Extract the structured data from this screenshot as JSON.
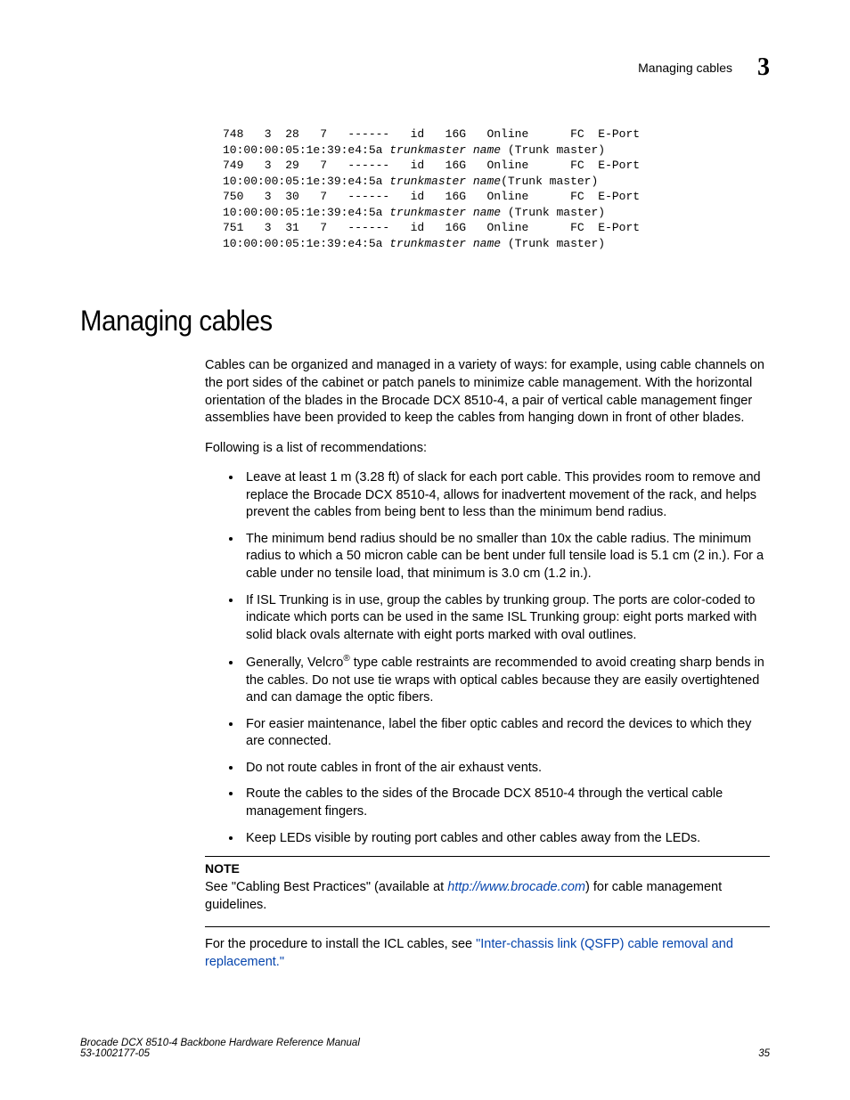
{
  "header": {
    "running_title": "Managing cables",
    "chapter_number": "3"
  },
  "code": {
    "rows": [
      {
        "line": "748   3  28   7   ------   id   16G   Online      FC  E-Port",
        "sub_pre": "10:00:00:05:1e:39:e4:5a ",
        "sub_em": "trunkmaster name",
        "sub_post": " (Trunk master)"
      },
      {
        "line": "749   3  29   7   ------   id   16G   Online      FC  E-Port",
        "sub_pre": "10:00:00:05:1e:39:e4:5a ",
        "sub_em": "trunkmaster name",
        "sub_post": "(Trunk master)"
      },
      {
        "line": "750   3  30   7   ------   id   16G   Online      FC  E-Port",
        "sub_pre": "10:00:00:05:1e:39:e4:5a ",
        "sub_em": "trunkmaster name",
        "sub_post": " (Trunk master)"
      },
      {
        "line": "751   3  31   7   ------   id   16G   Online      FC  E-Port",
        "sub_pre": "10:00:00:05:1e:39:e4:5a ",
        "sub_em": "trunkmaster name",
        "sub_post": " (Trunk master)"
      }
    ]
  },
  "section": {
    "title": "Managing cables",
    "intro1": "Cables can be organized and managed in a variety of ways: for example, using cable channels on the port sides of the cabinet or patch panels to minimize cable management.  With the horizontal orientation of the blades in the Brocade DCX 8510-4, a pair of vertical cable management finger assemblies have been provided to keep the cables from hanging down in front of other blades.",
    "intro2": "Following is a list of recommendations:",
    "bullets": [
      "Leave at least 1 m (3.28 ft) of slack for each port cable. This provides room to remove and replace the Brocade DCX 8510-4, allows for inadvertent movement of the rack, and helps prevent the cables from being bent to less than the minimum bend radius.",
      "The minimum bend radius should be no smaller than 10x the cable radius. The minimum radius to which a 50 micron cable can be bent under full tensile load is 5.1 cm (2 in.). For a cable under no tensile load, that minimum is 3.0 cm (1.2 in.).",
      "If ISL Trunking is in use, group the cables by trunking group. The ports are color-coded to indicate which ports can be used in the same ISL Trunking group: eight ports marked with solid black ovals alternate with eight ports marked with oval outlines.",
      {
        "pre": "Generally, Velcro",
        "sup": "®",
        "post": " type cable restraints are recommended to avoid creating sharp bends in the cables. Do not use tie wraps with optical cables because they are easily overtightened and can damage the optic fibers."
      },
      "For easier maintenance, label the fiber optic cables and record the devices to which they are connected.",
      "Do not route cables in front of the air exhaust vents.",
      "Route the cables to the sides of the Brocade DCX 8510-4 through the vertical cable management fingers.",
      "Keep LEDs visible by routing port cables and other cables away from the LEDs."
    ],
    "note": {
      "label": "NOTE",
      "pre": "See \"Cabling Best Practices\" (available at ",
      "link_text": "http://www.brocade.com",
      "post": ") for cable management guidelines."
    },
    "after_note": {
      "pre": "For the procedure to install the ICL cables, see ",
      "xref": "\"Inter-chassis link (QSFP) cable removal and replacement.\""
    }
  },
  "footer": {
    "title": "Brocade DCX 8510-4 Backbone Hardware Reference Manual",
    "docnum": "53-1002177-05",
    "page": "35"
  }
}
